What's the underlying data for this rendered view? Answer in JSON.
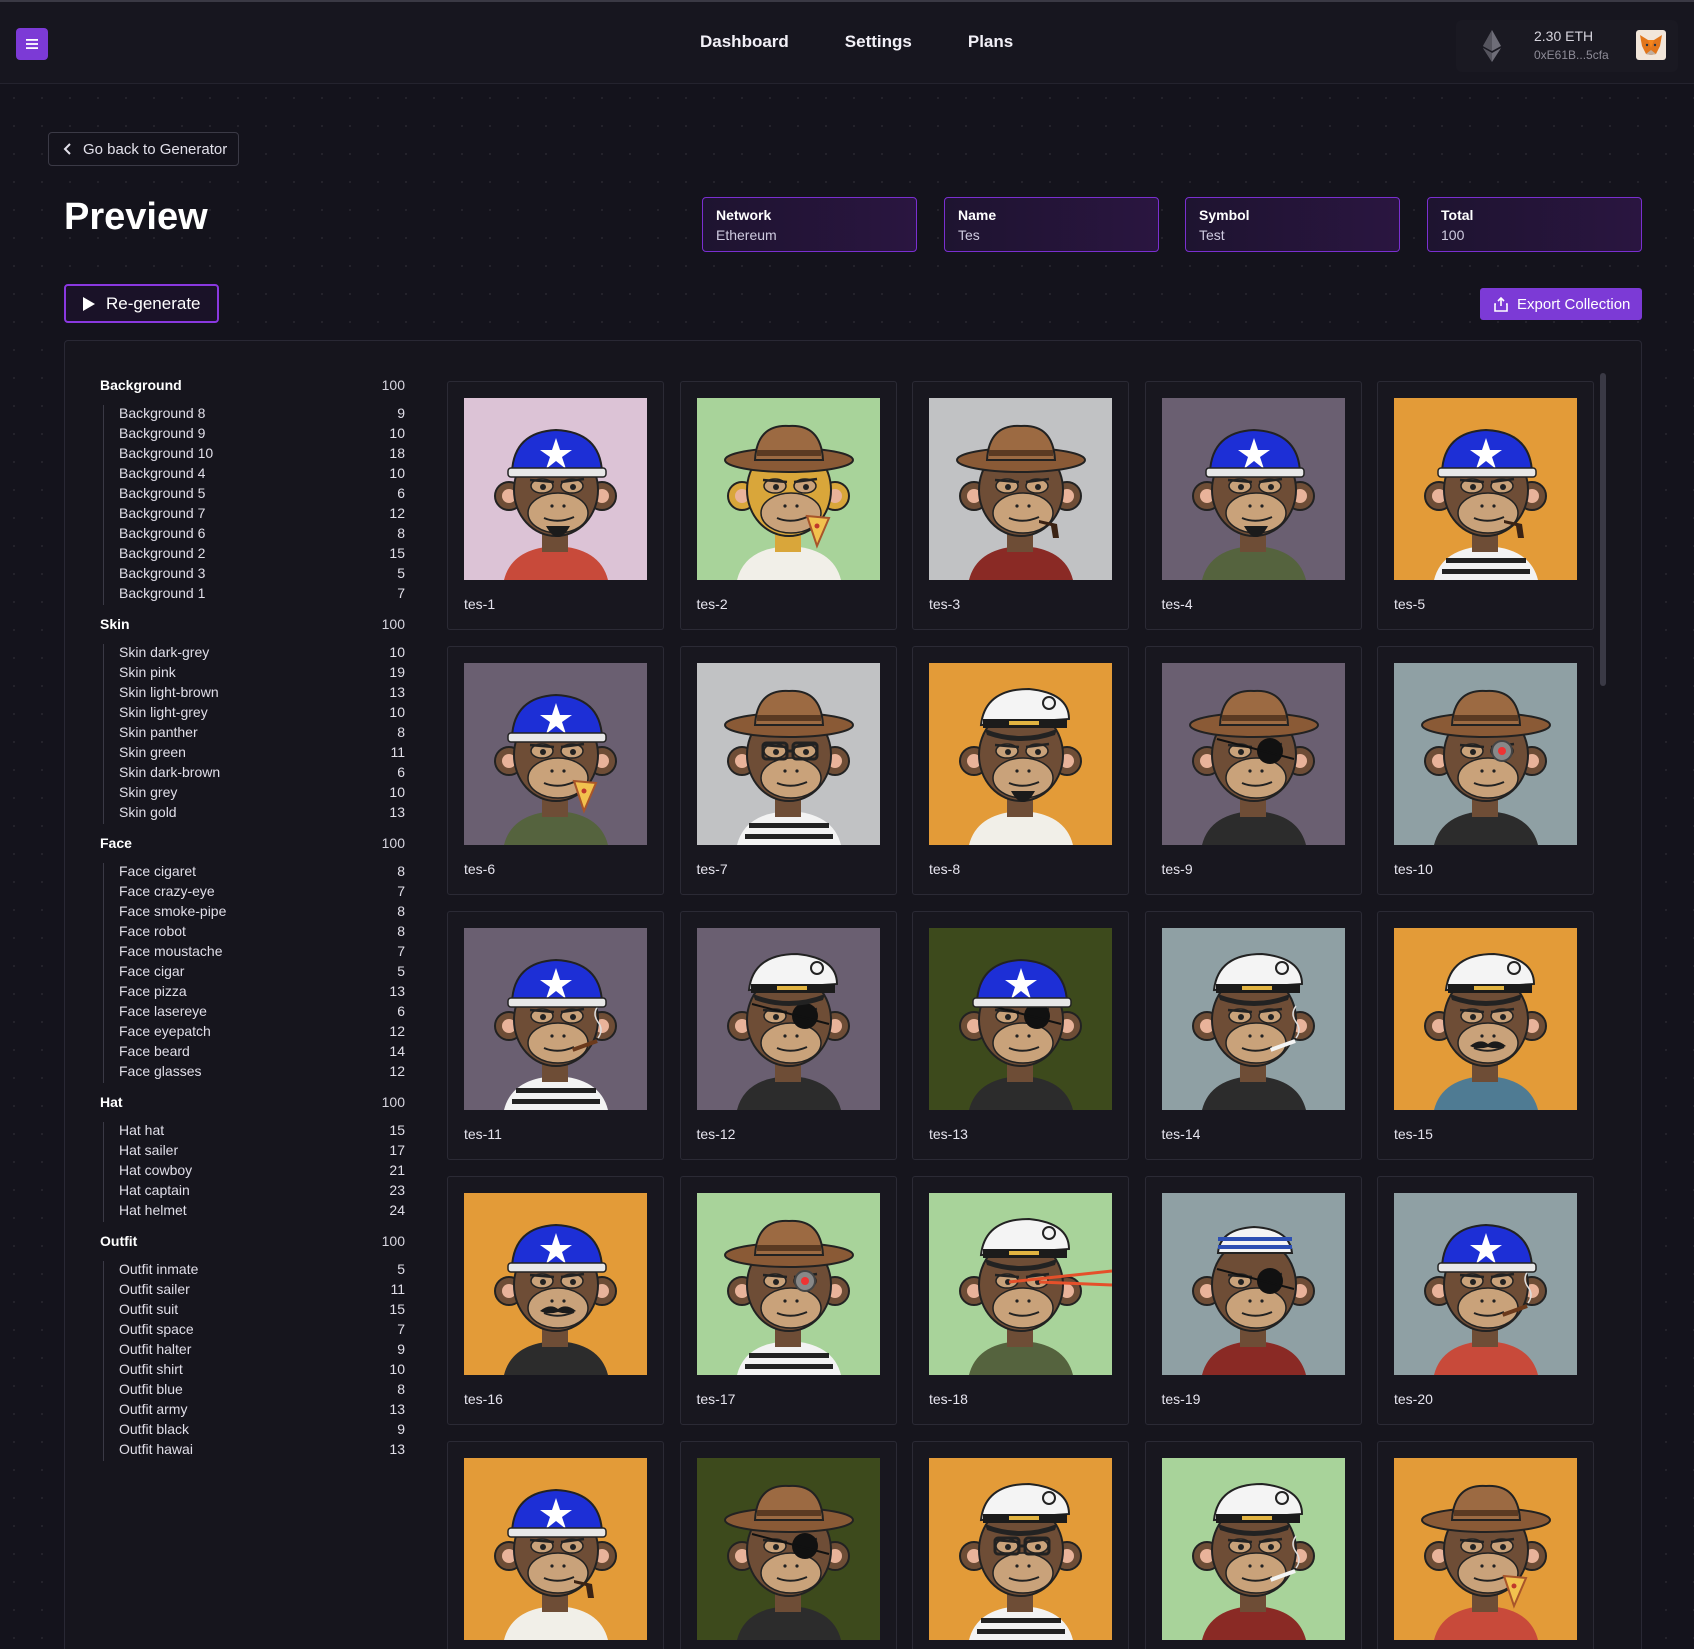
{
  "nav": {
    "links": [
      "Dashboard",
      "Settings",
      "Plans"
    ],
    "wallet": {
      "balance": "2.30 ETH",
      "address": "0xE61B...5cfa"
    }
  },
  "back_button": "Go back to Generator",
  "page_title": "Preview",
  "stats": [
    {
      "label": "Network",
      "value": "Ethereum"
    },
    {
      "label": "Name",
      "value": "Tes"
    },
    {
      "label": "Symbol",
      "value": "Test"
    },
    {
      "label": "Total",
      "value": "100"
    }
  ],
  "regenerate_label": "Re-generate",
  "export_label": "Export Collection",
  "colors": {
    "accent": "#7c3ad6",
    "background": "#14131c",
    "stat_border": "#7a2fd0"
  },
  "traits": [
    {
      "name": "Background",
      "total": "100",
      "items": [
        [
          "Background 8",
          "9"
        ],
        [
          "Background 9",
          "10"
        ],
        [
          "Background 10",
          "18"
        ],
        [
          "Background 4",
          "10"
        ],
        [
          "Background 5",
          "6"
        ],
        [
          "Background 7",
          "12"
        ],
        [
          "Background 6",
          "8"
        ],
        [
          "Background 2",
          "15"
        ],
        [
          "Background 3",
          "5"
        ],
        [
          "Background 1",
          "7"
        ]
      ]
    },
    {
      "name": "Skin",
      "total": "100",
      "items": [
        [
          "Skin dark-grey",
          "10"
        ],
        [
          "Skin pink",
          "19"
        ],
        [
          "Skin light-brown",
          "13"
        ],
        [
          "Skin light-grey",
          "10"
        ],
        [
          "Skin panther",
          "8"
        ],
        [
          "Skin green",
          "11"
        ],
        [
          "Skin dark-brown",
          "6"
        ],
        [
          "Skin grey",
          "10"
        ],
        [
          "Skin gold",
          "13"
        ]
      ]
    },
    {
      "name": "Face",
      "total": "100",
      "items": [
        [
          "Face cigaret",
          "8"
        ],
        [
          "Face crazy-eye",
          "7"
        ],
        [
          "Face smoke-pipe",
          "8"
        ],
        [
          "Face robot",
          "8"
        ],
        [
          "Face moustache",
          "7"
        ],
        [
          "Face cigar",
          "5"
        ],
        [
          "Face pizza",
          "13"
        ],
        [
          "Face lasereye",
          "6"
        ],
        [
          "Face eyepatch",
          "12"
        ],
        [
          "Face beard",
          "14"
        ],
        [
          "Face glasses",
          "12"
        ]
      ]
    },
    {
      "name": "Hat",
      "total": "100",
      "items": [
        [
          "Hat hat",
          "15"
        ],
        [
          "Hat sailer",
          "17"
        ],
        [
          "Hat cowboy",
          "21"
        ],
        [
          "Hat captain",
          "23"
        ],
        [
          "Hat helmet",
          "24"
        ]
      ]
    },
    {
      "name": "Outfit",
      "total": "100",
      "items": [
        [
          "Outfit inmate",
          "5"
        ],
        [
          "Outfit sailer",
          "11"
        ],
        [
          "Outfit suit",
          "15"
        ],
        [
          "Outfit space",
          "7"
        ],
        [
          "Outfit halter",
          "9"
        ],
        [
          "Outfit shirt",
          "10"
        ],
        [
          "Outfit blue",
          "8"
        ],
        [
          "Outfit army",
          "13"
        ],
        [
          "Outfit black",
          "9"
        ],
        [
          "Outfit hawai",
          "13"
        ]
      ]
    }
  ],
  "items": [
    {
      "name": "tes-1",
      "bg": "#dcc3d6",
      "hat": "helmet",
      "outfit": "#c84a3a",
      "face": "beard",
      "skin": "#6e4d36"
    },
    {
      "name": "tes-2",
      "bg": "#a8d39a",
      "hat": "cowboy",
      "outfit": "#f1efe8",
      "face": "pizza",
      "skin": "#d9a63a"
    },
    {
      "name": "tes-3",
      "bg": "#c1c2c4",
      "hat": "cowboy",
      "outfit": "#8a2a25",
      "face": "pipe",
      "skin": "#6e4d36"
    },
    {
      "name": "tes-4",
      "bg": "#6a5f71",
      "hat": "helmet",
      "outfit": "#55633e",
      "face": "beard",
      "skin": "#6e4d36"
    },
    {
      "name": "tes-5",
      "bg": "#e39b38",
      "hat": "helmet",
      "outfit": "#f3f3f3",
      "face": "pipe",
      "skin": "#6e4d36"
    },
    {
      "name": "tes-6",
      "bg": "#6a5f71",
      "hat": "helmet",
      "outfit": "#55633e",
      "face": "pizza",
      "skin": "#6e4d36"
    },
    {
      "name": "tes-7",
      "bg": "#c1c2c4",
      "hat": "cowboy",
      "outfit": "#f3f3f3",
      "face": "glasses",
      "skin": "#6e4d36"
    },
    {
      "name": "tes-8",
      "bg": "#e39b38",
      "hat": "captain",
      "outfit": "#f1efe8",
      "face": "beard",
      "skin": "#6e4d36"
    },
    {
      "name": "tes-9",
      "bg": "#6a5f71",
      "hat": "cowboy",
      "outfit": "#2c2c2c",
      "face": "eyepatch",
      "skin": "#6e4d36"
    },
    {
      "name": "tes-10",
      "bg": "#8fa0a4",
      "hat": "cowboy",
      "outfit": "#2c2c2c",
      "face": "robot",
      "skin": "#6e4d36"
    },
    {
      "name": "tes-11",
      "bg": "#6a5f71",
      "hat": "helmet",
      "outfit": "#f3f3f3",
      "face": "cigar",
      "skin": "#6e4d36"
    },
    {
      "name": "tes-12",
      "bg": "#6a5f71",
      "hat": "captain",
      "outfit": "#2c2c2c",
      "face": "eyepatch",
      "skin": "#6e4d36"
    },
    {
      "name": "tes-13",
      "bg": "#3d4a1c",
      "hat": "helmet",
      "outfit": "#2c2c2c",
      "face": "eyepatch",
      "skin": "#6e4d36"
    },
    {
      "name": "tes-14",
      "bg": "#8fa0a4",
      "hat": "captain",
      "outfit": "#2c2c2c",
      "face": "cigaret",
      "skin": "#6e4d36"
    },
    {
      "name": "tes-15",
      "bg": "#e39b38",
      "hat": "captain",
      "outfit": "#4f7b93",
      "face": "moustache",
      "skin": "#6e4d36"
    },
    {
      "name": "tes-16",
      "bg": "#e39b38",
      "hat": "helmet",
      "outfit": "#2c2c2c",
      "face": "moustache",
      "skin": "#6e4d36"
    },
    {
      "name": "tes-17",
      "bg": "#a8d39a",
      "hat": "cowboy",
      "outfit": "#f3f3f3",
      "face": "robot",
      "skin": "#6e4d36"
    },
    {
      "name": "tes-18",
      "bg": "#a8d39a",
      "hat": "captain",
      "outfit": "#55633e",
      "face": "laser",
      "skin": "#6e4d36"
    },
    {
      "name": "tes-19",
      "bg": "#8fa0a4",
      "hat": "sailor",
      "outfit": "#8a2a25",
      "face": "eyepatch",
      "skin": "#6e4d36"
    },
    {
      "name": "tes-20",
      "bg": "#8fa0a4",
      "hat": "helmet",
      "outfit": "#c84a3a",
      "face": "cigar",
      "skin": "#6e4d36"
    },
    {
      "name": "",
      "bg": "#e39b38",
      "hat": "helmet",
      "outfit": "#f1efe8",
      "face": "pipe",
      "skin": "#6e4d36"
    },
    {
      "name": "",
      "bg": "#3d4a1c",
      "hat": "cowboy",
      "outfit": "#2c2c2c",
      "face": "eyepatch",
      "skin": "#6e4d36"
    },
    {
      "name": "",
      "bg": "#e39b38",
      "hat": "captain",
      "outfit": "#f3f3f3",
      "face": "glasses",
      "skin": "#6e4d36"
    },
    {
      "name": "",
      "bg": "#a8d39a",
      "hat": "captain",
      "outfit": "#8a2a25",
      "face": "cigaret",
      "skin": "#6e4d36"
    },
    {
      "name": "",
      "bg": "#e39b38",
      "hat": "cowboy",
      "outfit": "#c84a3a",
      "face": "pizza",
      "skin": "#6e4d36"
    }
  ]
}
